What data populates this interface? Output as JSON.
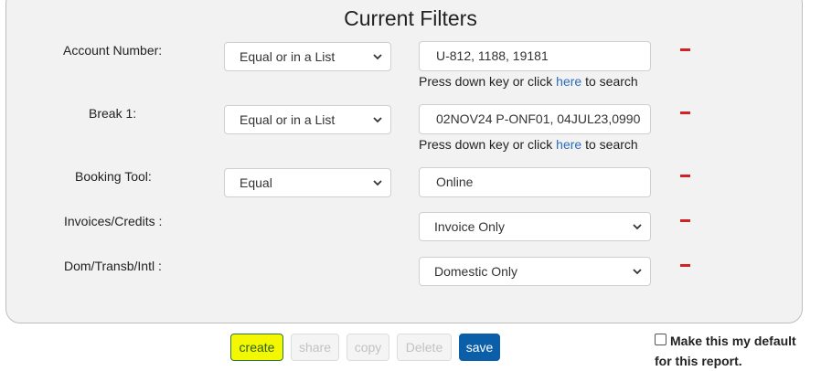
{
  "title": "Current Filters",
  "link_color": "#2a6ebd",
  "remove_color": "#d32222",
  "filters": [
    {
      "label": "Account Number:",
      "operator": "Equal or in a List",
      "value": "U-812, 1188, 19181",
      "hint": {
        "prefix": "Press down key or click ",
        "link": "here",
        "suffix": " to search"
      }
    },
    {
      "label": "Break 1:",
      "operator": "Equal or in a List",
      "value": "02NOV24 P-ONF01, 04JUL23,0990",
      "hint": {
        "prefix": "Press down key or click ",
        "link": "here",
        "suffix": " to search"
      }
    },
    {
      "label": "Booking Tool:",
      "operator": "Equal",
      "value": "Online"
    },
    {
      "label": "Invoices/Credits :",
      "value": "Invoice Only"
    },
    {
      "label": "Dom/Transb/Intl :",
      "value": "Domestic Only"
    }
  ],
  "actions": {
    "create": "create",
    "share": "share",
    "copy": "copy",
    "delete": "Delete",
    "save": "save",
    "save_color": "#0b5ea8",
    "highlight_color": "#f3f700"
  },
  "default_option": {
    "label": "Make this my default for this report.",
    "checked": false
  }
}
